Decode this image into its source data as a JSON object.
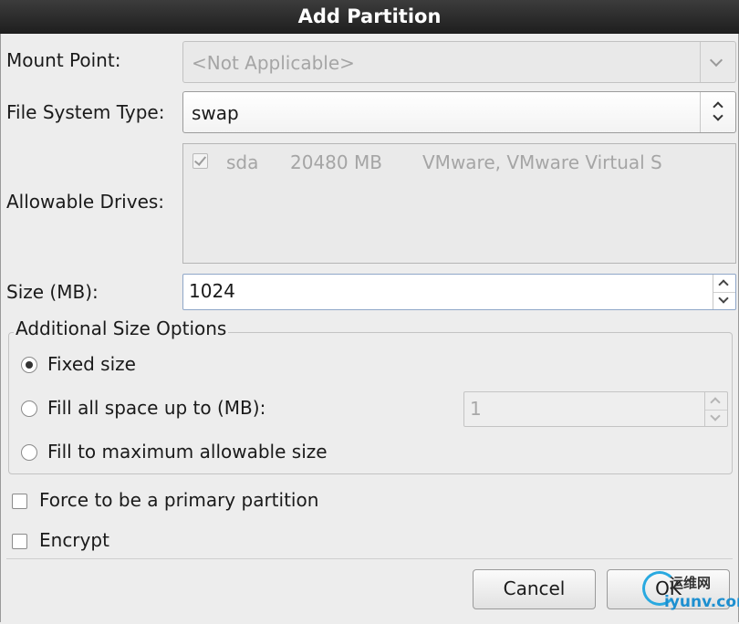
{
  "window": {
    "title": "Add Partition"
  },
  "mount_point": {
    "label": "Mount Point:",
    "value": "<Not Applicable>"
  },
  "fs_type": {
    "label": "File System Type:",
    "value": "swap"
  },
  "drives": {
    "label": "Allowable Drives:",
    "rows": [
      {
        "name": "sda",
        "size": "20480 MB",
        "model": "VMware, VMware Virtual S"
      }
    ]
  },
  "size": {
    "label": "Size (MB):",
    "value": "1024"
  },
  "options": {
    "title": "Additional Size Options",
    "fixed_label": "Fixed size",
    "fill_upto_label": "Fill all space up to (MB):",
    "fill_upto_value": "1",
    "fill_max_label": "Fill to maximum allowable size"
  },
  "force_primary": {
    "label": "Force to be a primary partition"
  },
  "encrypt": {
    "label": "Encrypt"
  },
  "buttons": {
    "cancel": "Cancel",
    "ok": "OK"
  },
  "watermark": {
    "top": "运维网",
    "bottom": "iyunv.com"
  }
}
